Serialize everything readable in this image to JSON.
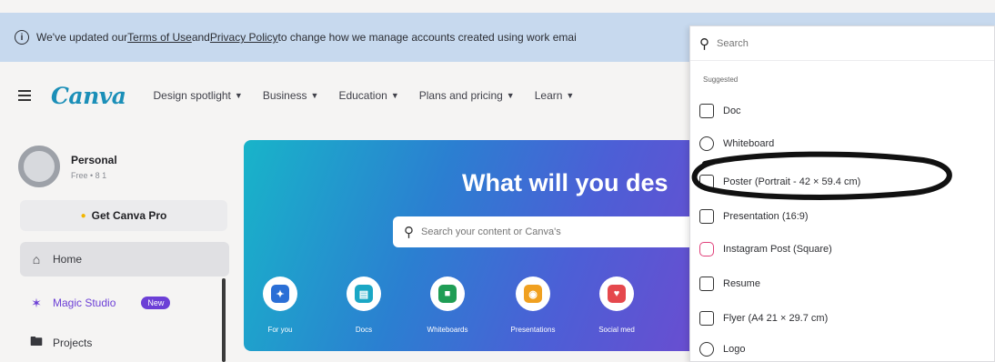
{
  "banner": {
    "prefix": "We've updated our ",
    "terms_link": "Terms of Use",
    "and": " and ",
    "privacy_link": "Privacy Policy",
    "suffix": " to change how we manage accounts created using work emai"
  },
  "topnav": {
    "logo": "Canva",
    "items": [
      {
        "label": "Design spotlight"
      },
      {
        "label": "Business"
      },
      {
        "label": "Education"
      },
      {
        "label": "Plans and pricing"
      },
      {
        "label": "Learn"
      }
    ]
  },
  "sidebar": {
    "profile_name": "Personal",
    "profile_sub": "Free • 8 1",
    "get_pro": "Get Canva Pro",
    "home": "Home",
    "magic_studio": "Magic Studio",
    "new_badge": "New",
    "projects": "Projects"
  },
  "hero": {
    "title": "What will you des",
    "search_placeholder": "Search your content or Canva's",
    "shortcuts": [
      {
        "label": "For you",
        "color": "#2b6fd6"
      },
      {
        "label": "Docs",
        "color": "#1aa7c5"
      },
      {
        "label": "Whiteboards",
        "color": "#1f9d55"
      },
      {
        "label": "Presentations",
        "color": "#f0a020"
      },
      {
        "label": "Social med",
        "color": "#e5484d"
      }
    ]
  },
  "dropdown": {
    "search_placeholder": "Search",
    "heading": "Suggested",
    "items": [
      {
        "label": "Doc",
        "icon": "doc-icon"
      },
      {
        "label": "Whiteboard",
        "icon": "whiteboard-icon"
      },
      {
        "label": "Poster (Portrait - 42 × 59.4 cm)",
        "icon": "poster-icon"
      },
      {
        "label": "Presentation (16:9)",
        "icon": "presentation-icon"
      },
      {
        "label": "Instagram Post (Square)",
        "icon": "instagram-icon"
      },
      {
        "label": "Resume",
        "icon": "resume-icon"
      },
      {
        "label": "Flyer (A4 21 × 29.7 cm)",
        "icon": "flyer-icon"
      },
      {
        "label": "Logo",
        "icon": "logo-icon"
      }
    ]
  }
}
